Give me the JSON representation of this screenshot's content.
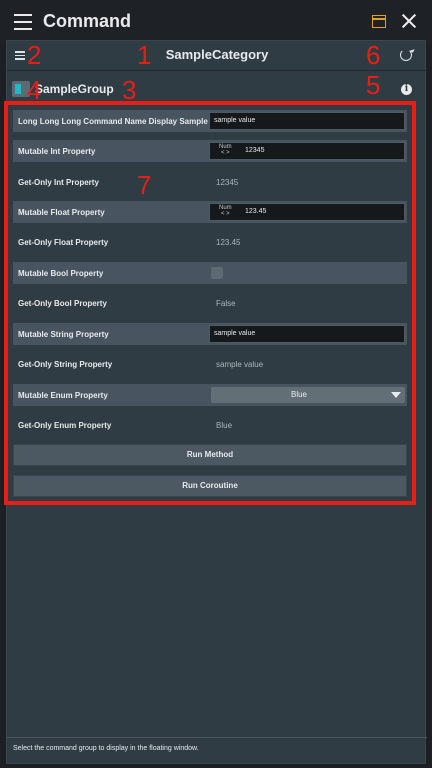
{
  "window": {
    "title": "Command"
  },
  "category": {
    "title": "SampleCategory"
  },
  "group": {
    "title": "SampleGroup"
  },
  "annotations": [
    "1",
    "2",
    "3",
    "4",
    "5",
    "6",
    "7"
  ],
  "rows": [
    {
      "label": "Long Long Long Command Name Display Sample",
      "value": "sample value"
    },
    {
      "label": "Mutable Int Property",
      "tag": "Num\n< >",
      "value": "12345"
    },
    {
      "label": "Get-Only Int Property",
      "value": "12345"
    },
    {
      "label": "Mutable Float Property",
      "tag": "Num\n< >",
      "value": "123.45"
    },
    {
      "label": "Get-Only Float Property",
      "value": "123.45"
    },
    {
      "label": "Mutable Bool Property"
    },
    {
      "label": "Get-Only Bool Property",
      "value": "False"
    },
    {
      "label": "Mutable String Property",
      "value": "sample value"
    },
    {
      "label": "Get-Only String Property",
      "value": "sample value"
    },
    {
      "label": "Mutable Enum Property",
      "value": "Blue"
    },
    {
      "label": "Get-Only Enum Property",
      "value": "Blue"
    }
  ],
  "buttons": {
    "run_method": "Run Method",
    "run_coroutine": "Run Coroutine"
  },
  "status": {
    "text": "Select the command group to display in the floating window."
  },
  "colors": {
    "annotation": "#e81f16",
    "accent_icon": "#e0a020",
    "group_icon": "#25b5c8"
  }
}
